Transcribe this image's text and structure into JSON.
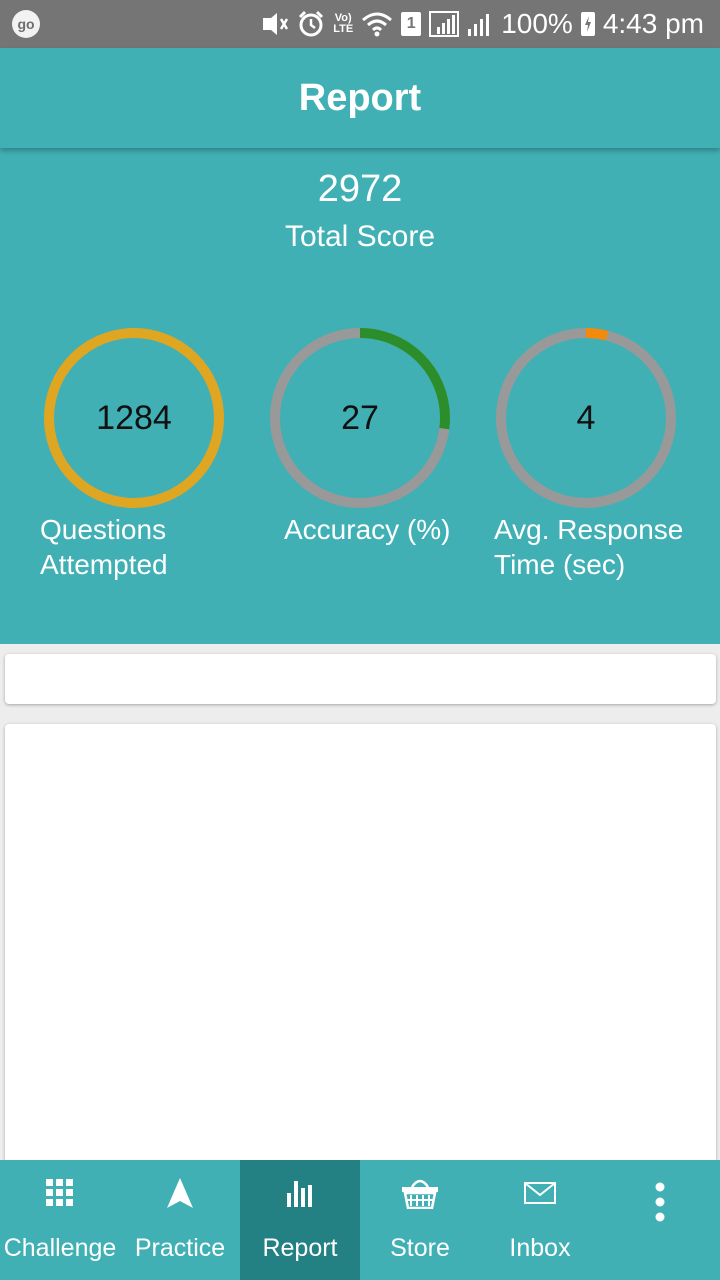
{
  "status_bar": {
    "left_badge": "go",
    "sim_slot": "1",
    "network": "LTE",
    "volte": "Vo)",
    "battery": "100%",
    "time": "4:43 pm"
  },
  "app_bar": {
    "title": "Report"
  },
  "summary": {
    "total_score_value": "2972",
    "total_score_label": "Total Score",
    "metrics": [
      {
        "value": "1284",
        "label_line1": "Questions",
        "label_line2": "Attempted",
        "ring_fraction": 1.0,
        "ring_color": "#dfa621"
      },
      {
        "value": "27",
        "label_line1": "Accuracy (%)",
        "label_line2": "",
        "ring_fraction": 0.27,
        "ring_color": "#2b8e2b"
      },
      {
        "value": "4",
        "label_line1": "Avg. Response",
        "label_line2": "Time (sec)",
        "ring_fraction": 0.04,
        "ring_color": "#f28a0c"
      }
    ],
    "ring_track_color": "#999999"
  },
  "bottom_nav": {
    "items": [
      {
        "label": "Challenge",
        "icon": "grid-icon"
      },
      {
        "label": "Practice",
        "icon": "navigation-arrow-icon"
      },
      {
        "label": "Report",
        "icon": "bar-chart-icon",
        "active": true
      },
      {
        "label": "Store",
        "icon": "basket-icon"
      },
      {
        "label": "Inbox",
        "icon": "envelope-icon"
      },
      {
        "label": "",
        "icon": "more-vert-icon"
      }
    ]
  },
  "colors": {
    "primary": "#40b0b5",
    "primary_dark": "#238184",
    "status_bar": "#757575"
  }
}
